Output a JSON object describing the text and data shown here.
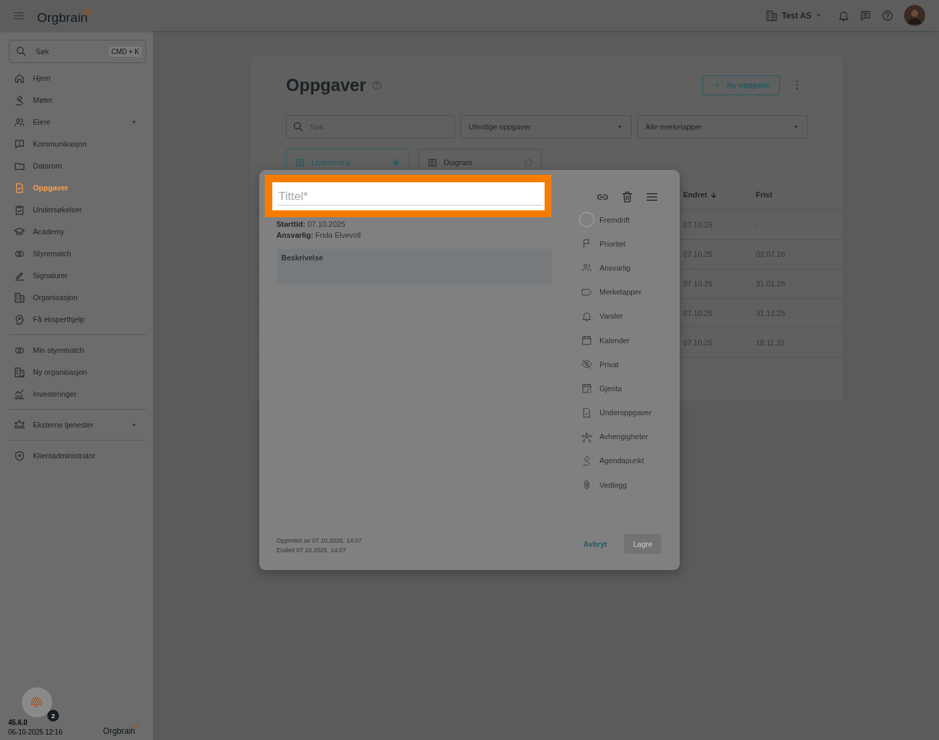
{
  "topbar": {
    "logo": "Orgbrain",
    "organization": "Test AS"
  },
  "sidebar": {
    "search": {
      "placeholder": "Søk",
      "shortcut": "CMD + K"
    },
    "groups": [
      {
        "items": [
          {
            "label": "Hjem",
            "selected": false,
            "expandable": false
          },
          {
            "label": "Møter",
            "selected": false,
            "expandable": false
          },
          {
            "label": "Eiere",
            "selected": false,
            "expandable": true
          },
          {
            "label": "Kommunikasjon",
            "selected": false,
            "expandable": false
          },
          {
            "label": "Datarom",
            "selected": false,
            "expandable": false
          },
          {
            "label": "Oppgaver",
            "selected": true,
            "expandable": false
          },
          {
            "label": "Undersøkelser",
            "selected": false,
            "expandable": false
          },
          {
            "label": "Academy",
            "selected": false,
            "expandable": false
          },
          {
            "label": "Styrematch",
            "selected": false,
            "expandable": false
          },
          {
            "label": "Signaturer",
            "selected": false,
            "expandable": false
          },
          {
            "label": "Organisasjon",
            "selected": false,
            "expandable": false
          },
          {
            "label": "Få eksperthjelp",
            "selected": false,
            "expandable": false
          }
        ]
      },
      {
        "items": [
          {
            "label": "Min styrematch",
            "selected": false,
            "expandable": false
          },
          {
            "label": "Ny organisasjon",
            "selected": false,
            "expandable": false
          },
          {
            "label": "Investeringer",
            "selected": false,
            "expandable": false
          }
        ]
      },
      {
        "items": [
          {
            "label": "Eksterne tjenester",
            "selected": false,
            "expandable": true
          }
        ]
      },
      {
        "items": [
          {
            "label": "Klientadministrator",
            "selected": false,
            "expandable": false
          }
        ]
      }
    ],
    "help_badge": "2",
    "version": "45.6.0",
    "build_date": "06-10-2025 12:16",
    "footer_logo": "Orgbrain"
  },
  "page": {
    "title": "Oppgaver",
    "new_button": "Ny oppgave",
    "search": {
      "placeholder": "Søk"
    },
    "filters": [
      "Uferdige oppgaver",
      "Alle merkelapper"
    ],
    "views": [
      {
        "label": "Listevisning",
        "selected": true
      },
      {
        "label": "Diagram",
        "selected": false
      }
    ],
    "table": {
      "columns": [
        "Endret",
        "Frist"
      ],
      "rows": [
        [
          "07.10.25",
          "-"
        ],
        [
          "07.10.25",
          "02.07.26"
        ],
        [
          "07.10.25",
          "31.01.26"
        ],
        [
          "07.10.25",
          "31.12.25"
        ],
        [
          "07.10.25",
          "18.11.25"
        ]
      ]
    }
  },
  "modal": {
    "title": {
      "placeholder": "Tittel*"
    },
    "details": [
      {
        "label": "Starttid:",
        "value": "07.10.2025"
      },
      {
        "label": "Ansvarlig:",
        "value": "Frida Elvevoll"
      }
    ],
    "description": {
      "placeholder": "Beskrivelse"
    },
    "actions": [
      "Fremdrift",
      "Prioritet",
      "Ansvarlig",
      "Merkelapper",
      "Varsler",
      "Kalender",
      "Privat",
      "Gjenta",
      "Underoppgaver",
      "Avhengigheter",
      "Agendapunkt",
      "Vedlegg"
    ],
    "created": "Opprettet av 07.10.2025, 14:07",
    "modified": "Endret 07.10.2025, 14:07",
    "cancel": "Avbryt",
    "save": {
      "label": "Lagre",
      "disabled": true
    }
  }
}
